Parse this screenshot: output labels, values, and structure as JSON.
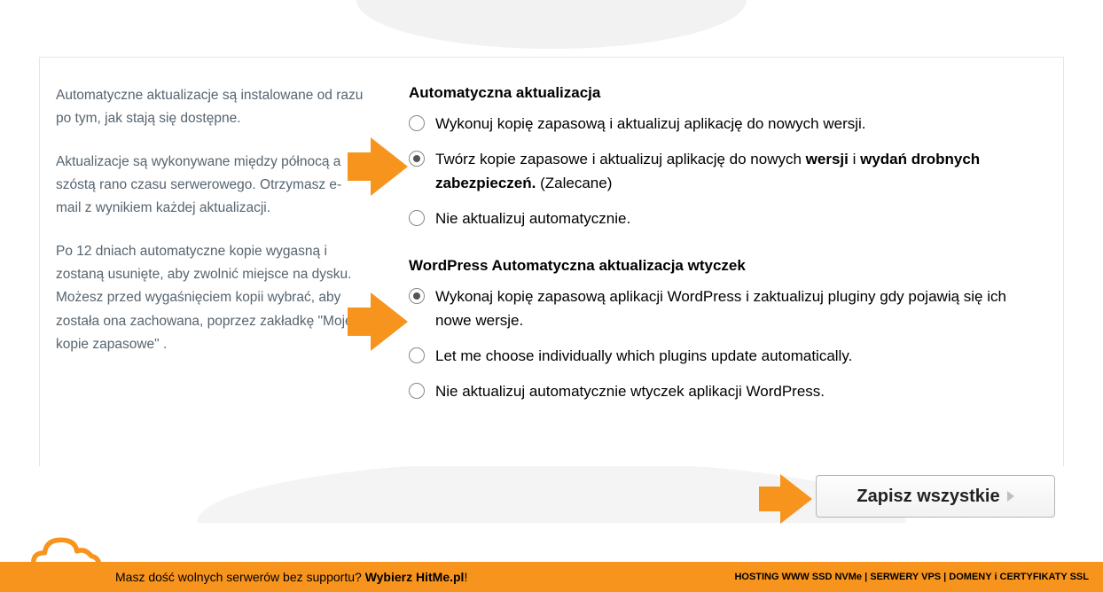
{
  "info": {
    "p1": "Automatyczne aktualizacje są instalowane od razu po tym, jak stają się dostępne.",
    "p2": "Aktualizacje są wykonywane między północą a szóstą rano czasu serwerowego. Otrzymasz e-mail z wynikiem każdej aktualizacji.",
    "p3": "Po 12 dniach automatyczne kopie wygasną i zostaną usunięte, aby zwolnić miejsce na dysku. Możesz przed wygaśnięciem kopii wybrać, aby została ona zachowana, poprzez zakładkę \"Moje kopie zapasowe\" ."
  },
  "section1": {
    "title": "Automatyczna aktualizacja",
    "options": [
      {
        "label": "Wykonuj kopię zapasową i aktualizuj aplikację do nowych wersji.",
        "selected": false
      },
      {
        "prefix": "Twórz kopie zapasowe i aktualizuj aplikację do nowych ",
        "bold1": "wersji",
        "mid": " i ",
        "bold2": "wydań drobnych zabezpieczeń.",
        "suffix": " (Zalecane)",
        "selected": true
      },
      {
        "label": "Nie aktualizuj automatycznie.",
        "selected": false
      }
    ]
  },
  "section2": {
    "title": "WordPress Automatyczna aktualizacja wtyczek",
    "options": [
      {
        "label": "Wykonaj kopię zapasową aplikacji WordPress i zaktualizuj pluginy gdy pojawią się ich nowe wersje.",
        "selected": true
      },
      {
        "label": "Let me choose individually which plugins update automatically.",
        "selected": false
      },
      {
        "label": "Nie aktualizuj automatycznie wtyczek aplikacji WordPress.",
        "selected": false
      }
    ]
  },
  "save_button": "Zapisz wszystkie",
  "footer": {
    "left_prefix": "Masz dość wolnych serwerów bez supportu? ",
    "left_bold": "Wybierz HitMe.pl",
    "left_suffix": "!",
    "right": "HOSTING WWW SSD NVMe | SERWERY VPS | DOMENY i CERTYFIKATY SSL"
  }
}
